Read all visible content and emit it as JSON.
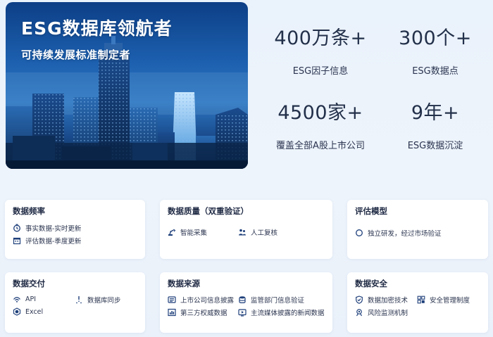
{
  "hero": {
    "title": "ESG数据库领航者",
    "subtitle": "可持续发展标准制定者"
  },
  "stats": [
    {
      "value": "400万条+",
      "label": "ESG因子信息"
    },
    {
      "value": "300个+",
      "label": "ESG数据点"
    },
    {
      "value": "4500家+",
      "label": "覆盖全部A股上市公司"
    },
    {
      "value": "9年+",
      "label": "ESG数据沉淀"
    }
  ],
  "cards": {
    "frequency": {
      "title": "数据频率",
      "items": [
        {
          "label": "事实数据-实时更新",
          "icon": "clock-icon"
        },
        {
          "label": "评估数据-季度更新",
          "icon": "calendar-icon"
        }
      ]
    },
    "quality": {
      "title": "数据质量（双重验证）",
      "items": [
        {
          "label": "智能采集",
          "icon": "robot-arm-icon"
        },
        {
          "label": "人工复核",
          "icon": "people-icon"
        }
      ]
    },
    "model": {
      "title": "评估模型",
      "items": [
        {
          "label": "独立研发，经过市场验证",
          "icon": "circle-icon"
        }
      ]
    },
    "delivery": {
      "title": "数据交付",
      "items": [
        {
          "label": "API",
          "icon": "api-icon"
        },
        {
          "label": "数据库同步",
          "icon": "sync-icon"
        },
        {
          "label": "Excel",
          "icon": "excel-icon"
        }
      ]
    },
    "source": {
      "title": "数据来源",
      "items": [
        {
          "label": "上市公司信息披露",
          "icon": "document-icon"
        },
        {
          "label": "监管部门信息验证",
          "icon": "database-icon"
        },
        {
          "label": "第三方权威数据",
          "icon": "chart-icon"
        },
        {
          "label": "主流媒体披露的新闻数据",
          "icon": "media-icon"
        }
      ]
    },
    "security": {
      "title": "数据安全",
      "items": [
        {
          "label": "数据加密技术",
          "icon": "shield-icon"
        },
        {
          "label": "安全管理制度",
          "icon": "grid-icon"
        },
        {
          "label": "风险监测机制",
          "icon": "monitor-icon"
        }
      ]
    }
  },
  "colors": {
    "accent": "#1e3f7a",
    "background": "#eaf2fb",
    "card": "#ffffff"
  }
}
